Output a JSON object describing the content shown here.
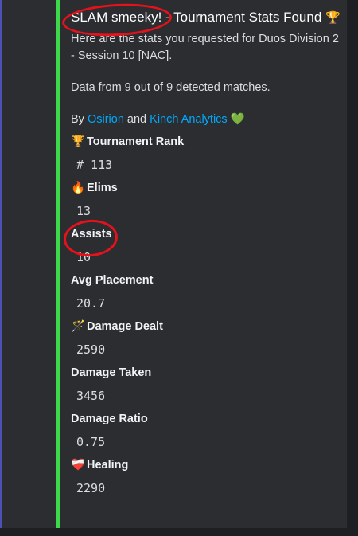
{
  "embed": {
    "title": "SLAM smeeky! - Tournament Stats Found",
    "title_emoji": "🏆",
    "description_line1": "Here are the stats you requested for Duos Division 2 - Session 10 [NAC].",
    "description_line2": "Data from 9 out of 9 detected matches.",
    "by_prefix": "By",
    "author1": "Osirion",
    "and": "and",
    "author2": "Kinch Analytics",
    "author_emoji": "💚",
    "accent_color": "#3ed84b",
    "link_color": "#00a8fc"
  },
  "fields": [
    {
      "emoji": "🏆",
      "name": "Tournament Rank",
      "value": "# 113"
    },
    {
      "emoji": "🔥",
      "name": "Elims",
      "value": "13"
    },
    {
      "emoji": "",
      "name": "Assists",
      "value": "10"
    },
    {
      "emoji": "",
      "name": "Avg Placement",
      "value": "20.7"
    },
    {
      "emoji": "🪄",
      "name": "Damage Dealt",
      "value": "2590"
    },
    {
      "emoji": "",
      "name": "Damage Taken",
      "value": "3456"
    },
    {
      "emoji": "",
      "name": "Damage Ratio",
      "value": "0.75"
    },
    {
      "emoji": "❤️‍🩹",
      "name": "Healing",
      "value": "2290"
    }
  ],
  "annotation_color": "#e3121b"
}
